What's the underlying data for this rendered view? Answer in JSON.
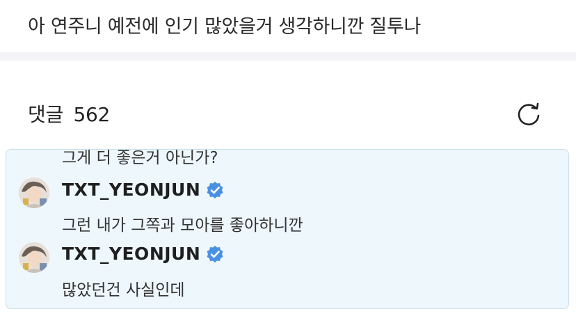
{
  "post": {
    "text": "아 연주니 예전에 인기 많았을거 생각하니깐 질투나"
  },
  "comments": {
    "label": "댓글",
    "count": "562",
    "refresh_icon": "refresh-icon"
  },
  "replies": {
    "clipped_text": "그게 더 좋은거 아닌가?",
    "items": [
      {
        "username": "TXT_YEONJUN",
        "verified_icon": "verified-badge-icon",
        "text": "그런 내가 그쪽과 모아를 좋아하니깐"
      },
      {
        "username": "TXT_YEONJUN",
        "verified_icon": "verified-badge-icon",
        "text": "많았던건 사실인데"
      }
    ]
  },
  "colors": {
    "reply_bg": "#eef7fc",
    "reply_border": "#c8e0ec",
    "verified": "#4a90e2",
    "divider": "#f4f4f6"
  }
}
